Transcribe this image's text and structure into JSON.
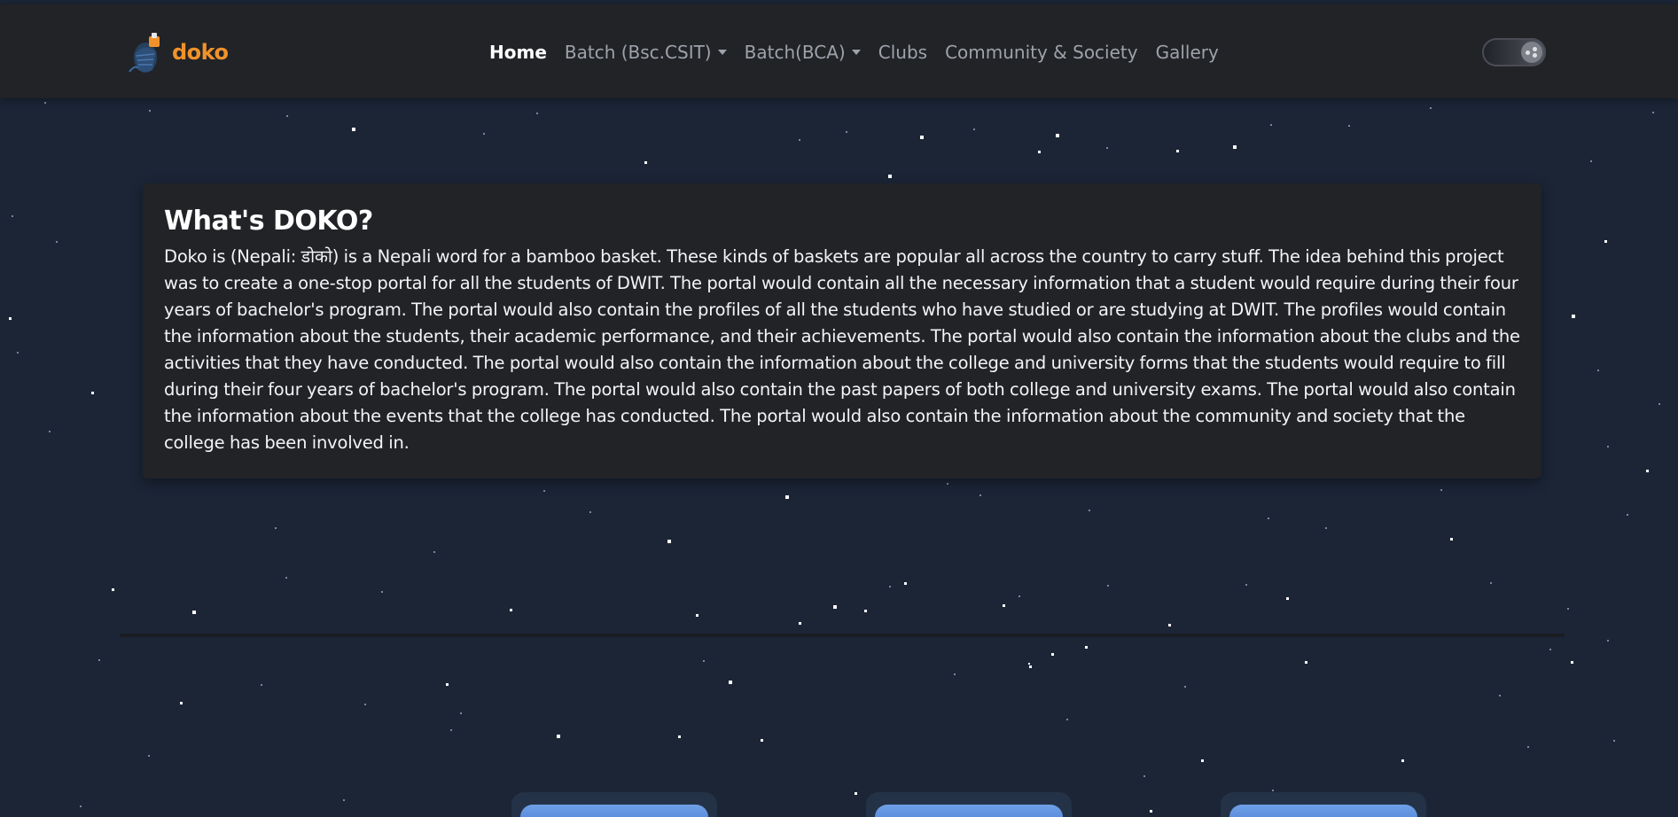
{
  "brand": {
    "name": "doko",
    "logo_icon": "doko-basket-logo-icon",
    "accent_color": "#f0922b"
  },
  "nav": {
    "items": [
      {
        "label": "Home",
        "active": true,
        "dropdown": false
      },
      {
        "label": "Batch (Bsc.CSIT)",
        "active": false,
        "dropdown": true
      },
      {
        "label": "Batch(BCA)",
        "active": false,
        "dropdown": true
      },
      {
        "label": "Clubs",
        "active": false,
        "dropdown": false
      },
      {
        "label": "Community & Society",
        "active": false,
        "dropdown": false
      },
      {
        "label": "Gallery",
        "active": false,
        "dropdown": false
      }
    ]
  },
  "theme_toggle": {
    "icon": "theme-toggle-icon",
    "state": "dark"
  },
  "about": {
    "title": "What's DOKO?",
    "body": "Doko is (Nepali: डोको) is a Nepali word for a bamboo basket. These kinds of baskets are popular all across the country to carry stuff. The idea behind this project was to create a one-stop portal for all the students of DWIT. The portal would contain all the necessary information that a student would require during their four years of bachelor's program. The portal would also contain the profiles of all the students who have studied or are studying at DWIT. The profiles would contain the information about the students, their academic performance, and their achievements. The portal would also contain the information about the clubs and the activities that they have conducted. The portal would also contain the information about the college and university forms that the students would require to fill during their four years of bachelor's program. The portal would also contain the past papers of both college and university exams. The portal would also contain the information about the events that the college has conducted. The portal would also contain the information about the community and society that the college has been involved in."
  },
  "colors": {
    "page_background": "#1b2536",
    "navbar_background": "#212327",
    "card_background": "#212327",
    "nav_text": "#9ea3aa",
    "nav_active_text": "#ffffff"
  }
}
